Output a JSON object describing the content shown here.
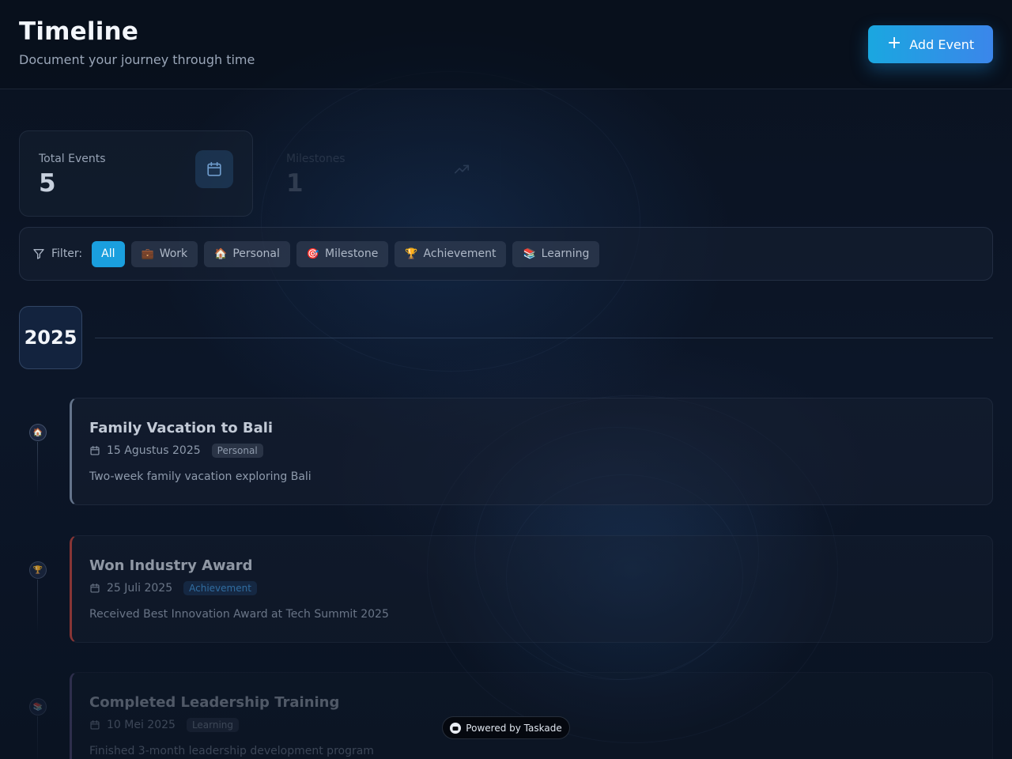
{
  "header": {
    "title": "Timeline",
    "subtitle": "Document your journey through time",
    "add_button_label": "Add Event"
  },
  "stats": [
    {
      "label": "Total Events",
      "value": "5",
      "icon": "calendar-icon"
    },
    {
      "label": "Milestones",
      "value": "1",
      "icon": "trending-up-icon"
    }
  ],
  "filter": {
    "label": "Filter:",
    "options": [
      {
        "label": "All",
        "emoji": "",
        "active": true
      },
      {
        "label": "Work",
        "emoji": "💼",
        "active": false
      },
      {
        "label": "Personal",
        "emoji": "🏠",
        "active": false
      },
      {
        "label": "Milestone",
        "emoji": "🎯",
        "active": false
      },
      {
        "label": "Achievement",
        "emoji": "🏆",
        "active": false
      },
      {
        "label": "Learning",
        "emoji": "📚",
        "active": false
      }
    ]
  },
  "timeline": {
    "year": "2025",
    "events": [
      {
        "title": "Family Vacation to Bali",
        "date": "15 Agustus 2025",
        "category": "Personal",
        "emoji": "🏠",
        "description": "Two-week family vacation exploring Bali",
        "accent": "#64748b",
        "tag_color": "#8e9aac"
      },
      {
        "title": "Won Industry Award",
        "date": "25 Juli 2025",
        "category": "Achievement",
        "emoji": "🏆",
        "description": "Received Best Innovation Award at Tech Summit 2025",
        "accent": "#b9423c",
        "tag_color": "#3f8fd0"
      },
      {
        "title": "Completed Leadership Training",
        "date": "10 Mei 2025",
        "category": "Learning",
        "emoji": "📚",
        "description": "Finished 3-month leadership development program",
        "accent": "#6a5b8f",
        "tag_color": "#8e9aac"
      }
    ]
  },
  "footer": {
    "powered_by": "Powered by Taskade"
  },
  "colors": {
    "accent": "#1a9fde",
    "background": "#0b1322"
  }
}
